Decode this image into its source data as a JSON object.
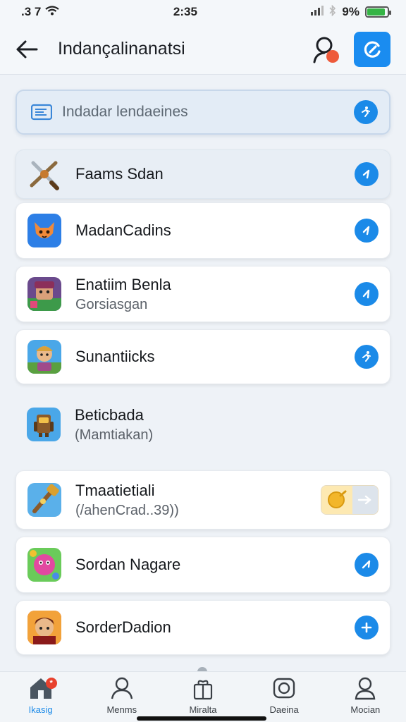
{
  "status_bar": {
    "time_left": ".3 7",
    "time": "2:35",
    "battery": "9%",
    "battery_level": 0.9
  },
  "header": {
    "title": "Indançalinanatsi"
  },
  "search": {
    "placeholder": "Indadar lendaeines"
  },
  "list": [
    {
      "title": "Faams Sdan",
      "subtitle": "",
      "icon": "crossed-swords-icon",
      "action": "check-icon",
      "highlight": true
    },
    {
      "title": "MadanCadins",
      "subtitle": "",
      "icon": "fox-face-icon",
      "action": "check-icon"
    },
    {
      "title": "Enatiim Benla",
      "subtitle": "Gorsiasgan",
      "icon": "game-character-icon",
      "action": "check-icon"
    },
    {
      "title": "Sunantiicks",
      "subtitle": "",
      "icon": "hero-avatar-icon",
      "action": "run-icon"
    },
    {
      "title": "Beticbada",
      "subtitle": "(Mamtiakan)",
      "icon": "robot-icon",
      "action": "",
      "plain": true
    },
    {
      "title": "Tmaatietiali",
      "subtitle": "(/ahenCrad..39))",
      "icon": "hammer-icon",
      "action": "coin-toggle"
    },
    {
      "title": "Sordan Nagare",
      "subtitle": "",
      "icon": "candy-icon",
      "action": "check-icon"
    },
    {
      "title": "SorderDadion",
      "subtitle": "",
      "icon": "warrior-icon",
      "action": "plus-icon"
    }
  ],
  "nav": [
    {
      "label": "Ikasig",
      "icon": "home-icon",
      "active": true,
      "badge": "*"
    },
    {
      "label": "Menms",
      "icon": "person-icon"
    },
    {
      "label": "Miralta",
      "icon": "gift-icon"
    },
    {
      "label": "Daeina",
      "icon": "camera-icon"
    },
    {
      "label": "Mocian",
      "icon": "profile-icon"
    }
  ],
  "colors": {
    "accent": "#1b8ae8",
    "background": "#eef2f7",
    "badge": "#e8412d"
  }
}
